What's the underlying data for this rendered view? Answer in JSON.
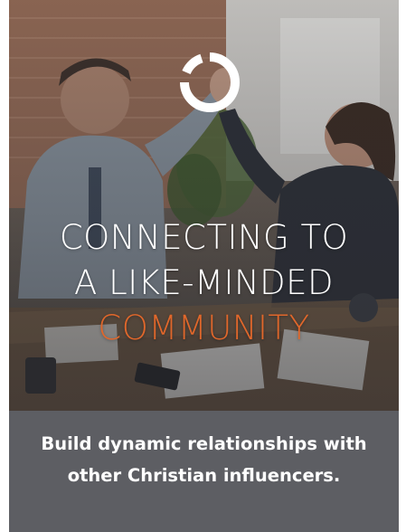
{
  "hero": {
    "logo_icon": "circular-arc-logo-icon",
    "headline_line1": "CONNECTING TO",
    "headline_line2": "A LIKE-MINDED",
    "headline_line3": "COMMUNITY",
    "accent_color": "#e0672b"
  },
  "caption": {
    "text": "Build dynamic relationships with other Christian influencers."
  },
  "colors": {
    "caption_background": "#5d5e63",
    "text": "#ffffff"
  }
}
